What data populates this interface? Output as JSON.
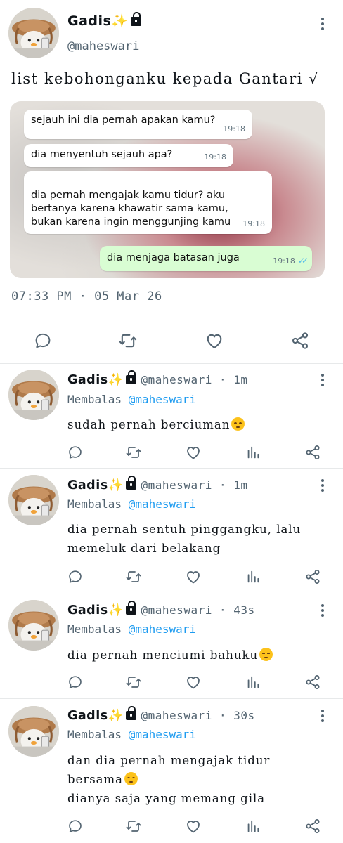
{
  "main_post": {
    "display_name": "Gadis",
    "handle": "@maheswari",
    "text": "list kebohonganku kepada Gantari √",
    "timestamp": "07:33 PM · 05 Mar 26",
    "chat": [
      {
        "text": "sejauh ini dia pernah apakan kamu?",
        "time": "19:18",
        "direction": "in"
      },
      {
        "text": "dia menyentuh sejauh apa?",
        "time": "19:18",
        "direction": "in"
      },
      {
        "text": "dia pernah mengajak kamu tidur? aku\nbertanya karena khawatir sama kamu,\nbukan karena ingin menggunjing kamu",
        "time": "19:18",
        "direction": "in"
      },
      {
        "text": "dia menjaga batasan juga",
        "time": "19:18",
        "direction": "out"
      }
    ],
    "actions": [
      "reply-icon",
      "retweet-icon",
      "like-icon",
      "share-icon"
    ]
  },
  "replies": [
    {
      "display_name": "Gadis",
      "handle": "@maheswari",
      "age": "1m",
      "replying_label": "Membalas",
      "replying_to": "@maheswari",
      "text": "sudah pernah berciuman",
      "emoji": "pensive-face"
    },
    {
      "display_name": "Gadis",
      "handle": "@maheswari",
      "age": "1m",
      "replying_label": "Membalas",
      "replying_to": "@maheswari",
      "text": "dia pernah sentuh pinggangku, lalu\nmemeluk dari belakang",
      "emoji": ""
    },
    {
      "display_name": "Gadis",
      "handle": "@maheswari",
      "age": "43s",
      "replying_label": "Membalas",
      "replying_to": "@maheswari",
      "text": "dia pernah menciumi bahuku",
      "emoji": "pensive-face"
    },
    {
      "display_name": "Gadis",
      "handle": "@maheswari",
      "age": "30s",
      "replying_label": "Membalas",
      "replying_to": "@maheswari",
      "text_line1": "dan dia pernah mengajak tidur",
      "text_line2": "bersama",
      "text_line3": "dianya saja yang memang gila",
      "emoji": "pensive-face"
    }
  ],
  "colors": {
    "accent": "#1d9bf0",
    "muted": "#536471",
    "chat_out": "#d9fdd3",
    "read_ticks": "#53bdeb"
  },
  "icons": {
    "badge": "sparkles-icon",
    "protected": "lock-icon",
    "reply_actions": [
      "reply-icon",
      "retweet-icon",
      "like-icon",
      "views-icon",
      "share-icon"
    ]
  }
}
